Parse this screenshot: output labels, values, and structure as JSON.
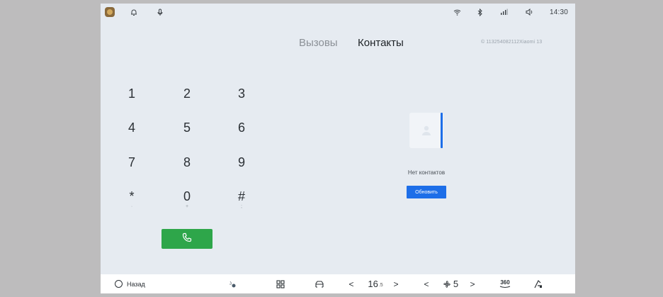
{
  "colors": {
    "outer_bg": "#bdbcbd",
    "screen_bg": "#e6ebf1",
    "accent": "#1d6ee8",
    "call_green": "#2ea64a"
  },
  "status_bar": {
    "left_icons": [
      "avatar-icon",
      "bell-icon",
      "microphone-icon"
    ],
    "right_icons": [
      "wifi-icon",
      "bluetooth-icon",
      "signal-icon",
      "volume-icon"
    ],
    "time": "14:30"
  },
  "tabs": [
    {
      "label": "Вызовы",
      "active": false
    },
    {
      "label": "Контакты",
      "active": true
    }
  ],
  "device_id": "© 113254082112Xiaomi 13",
  "keypad": [
    {
      "digit": "1",
      "sub": ""
    },
    {
      "digit": "2",
      "sub": ""
    },
    {
      "digit": "3",
      "sub": ""
    },
    {
      "digit": "4",
      "sub": ""
    },
    {
      "digit": "5",
      "sub": ""
    },
    {
      "digit": "6",
      "sub": ""
    },
    {
      "digit": "7",
      "sub": ""
    },
    {
      "digit": "8",
      "sub": ""
    },
    {
      "digit": "9",
      "sub": ""
    },
    {
      "digit": "*",
      "sub": "·"
    },
    {
      "digit": "0",
      "sub": "+"
    },
    {
      "digit": "#",
      "sub": ";"
    }
  ],
  "call_button_icon": "phone-icon",
  "contacts": {
    "empty_text": "Нет контактов",
    "refresh_label": "Обновить"
  },
  "bottom_bar": {
    "back_label": "Назад",
    "temperature_left": "16",
    "temperature_left_sub": ".5",
    "fan_level": "5",
    "camera_label": "360",
    "prev_symbol": "<",
    "next_symbol": ">"
  }
}
